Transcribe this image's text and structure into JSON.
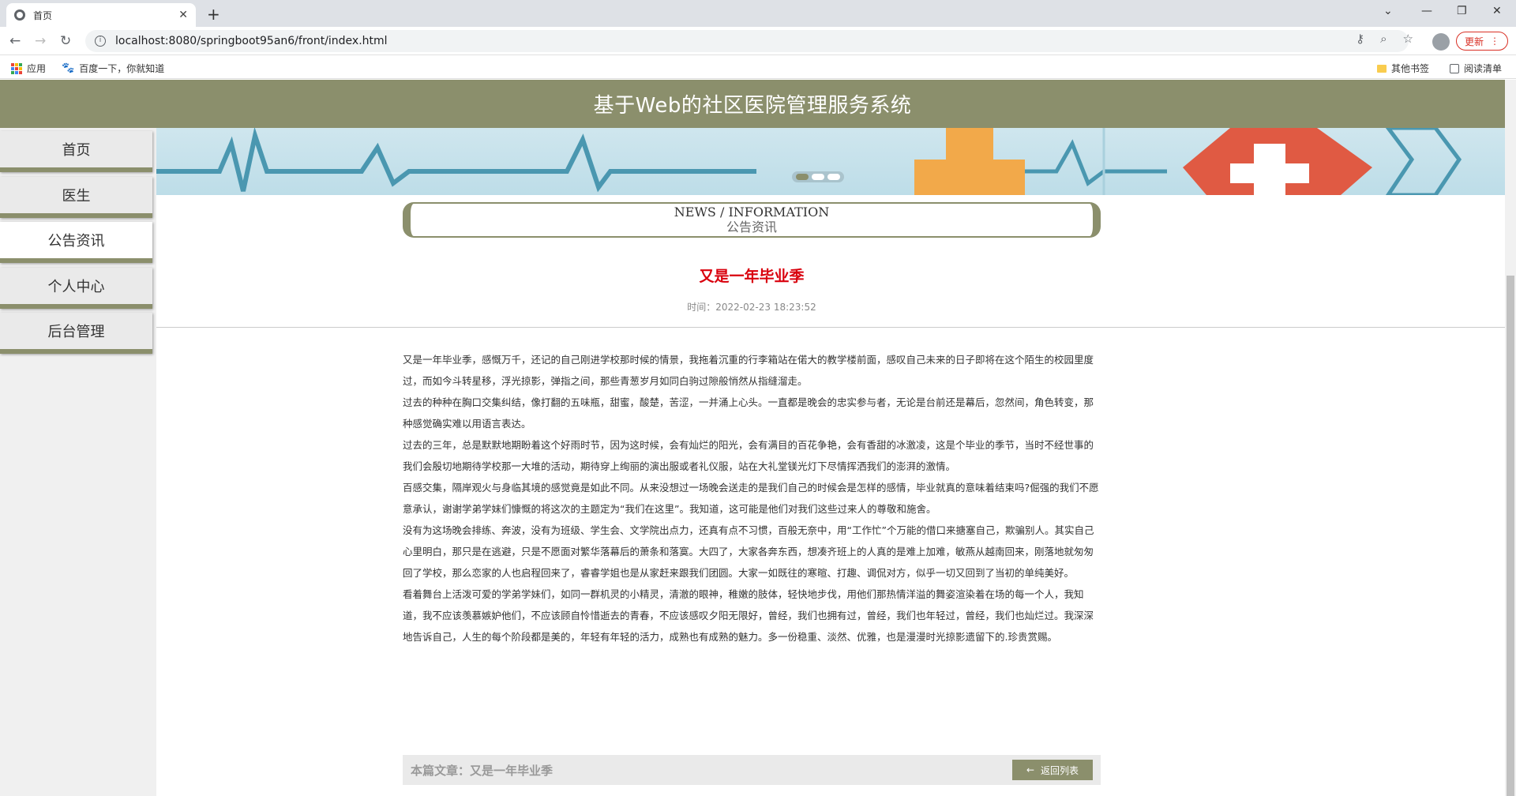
{
  "browser": {
    "tab_title": "首页",
    "url": "localhost:8080/springboot95an6/front/index.html",
    "update_label": "更新",
    "bookmarks": {
      "apps": "应用",
      "baidu": "百度一下，你就知道",
      "others": "其他书签",
      "reading": "阅读清单"
    }
  },
  "site": {
    "title": "基于Web的社区医院管理服务系统"
  },
  "nav": {
    "items": [
      {
        "label": "首页"
      },
      {
        "label": "医生"
      },
      {
        "label": "公告资讯"
      },
      {
        "label": "个人中心"
      },
      {
        "label": "后台管理"
      }
    ],
    "active_index": 2
  },
  "section": {
    "title_en": "NEWS / INFORMATION",
    "title_cn": "公告资讯"
  },
  "article": {
    "title": "又是一年毕业季",
    "time": "时间：2022-02-23 18:23:52",
    "paragraphs": [
      "又是一年毕业季，感慨万千，还记的自己刚进学校那时候的情景，我拖着沉重的行李箱站在偌大的教学楼前面，感叹自己未来的日子即将在这个陌生的校园里度过，而如今斗转星移，浮光掠影，弹指之间，那些青葱岁月如同白驹过隙般悄然从指缝溜走。",
      "过去的种种在胸口交集纠结，像打翻的五味瓶，甜蜜，酸楚，苦涩，一并涌上心头。一直都是晚会的忠实参与者，无论是台前还是幕后，忽然间，角色转变，那种感觉确实难以用语言表达。",
      "过去的三年，总是默默地期盼着这个好雨时节，因为这时候，会有灿烂的阳光，会有满目的百花争艳，会有香甜的冰激凌，这是个毕业的季节，当时不经世事的我们会殷切地期待学校那一大堆的活动，期待穿上绚丽的演出服或者礼仪服，站在大礼堂镁光灯下尽情挥洒我们的澎湃的激情。",
      "百感交集，隔岸观火与身临其境的感觉竟是如此不同。从来没想过一场晚会送走的是我们自己的时候会是怎样的感情，毕业就真的意味着结束吗?倔强的我们不愿意承认，谢谢学弟学妹们慷慨的将这次的主题定为“我们在这里”。我知道，这可能是他们对我们这些过来人的尊敬和施舍。",
      "没有为这场晚会排练、奔波，没有为班级、学生会、文学院出点力，还真有点不习惯，百般无奈中，用“工作忙”个万能的借口来搪塞自己，欺骗别人。其实自己心里明白，那只是在逃避，只是不愿面对繁华落幕后的萧条和落寞。大四了，大家各奔东西，想凑齐班上的人真的是难上加难，敏燕从越南回来，刚落地就匆匆回了学校，那么恋家的人也启程回来了，睿睿学姐也是从家赶来跟我们团圆。大家一如既往的寒暄、打趣、调侃对方，似乎一切又回到了当初的单纯美好。",
      "看着舞台上活泼可爱的学弟学妹们，如同一群机灵的小精灵，清澈的眼神，稚嫩的肢体，轻快地步伐，用他们那热情洋溢的舞姿渲染着在场的每一个人，我知道，我不应该羡慕嫉妒他们，不应该顾自怜惜逝去的青春，不应该感叹夕阳无限好，曾经，我们也拥有过，曾经，我们也年轻过，曾经，我们也灿烂过。我深深地告诉自己，人生的每个阶段都是美的，年轻有年轻的活力，成熟也有成熟的魅力。多一份稳重、淡然、优雅，也是漫漫时光掠影遗留下的.珍贵赏赐。"
    ],
    "current_label": "本篇文章：又是一年毕业季",
    "back_label": "返回列表"
  },
  "colors": {
    "accent": "#8b8f6c",
    "title_red": "#d9000d"
  }
}
